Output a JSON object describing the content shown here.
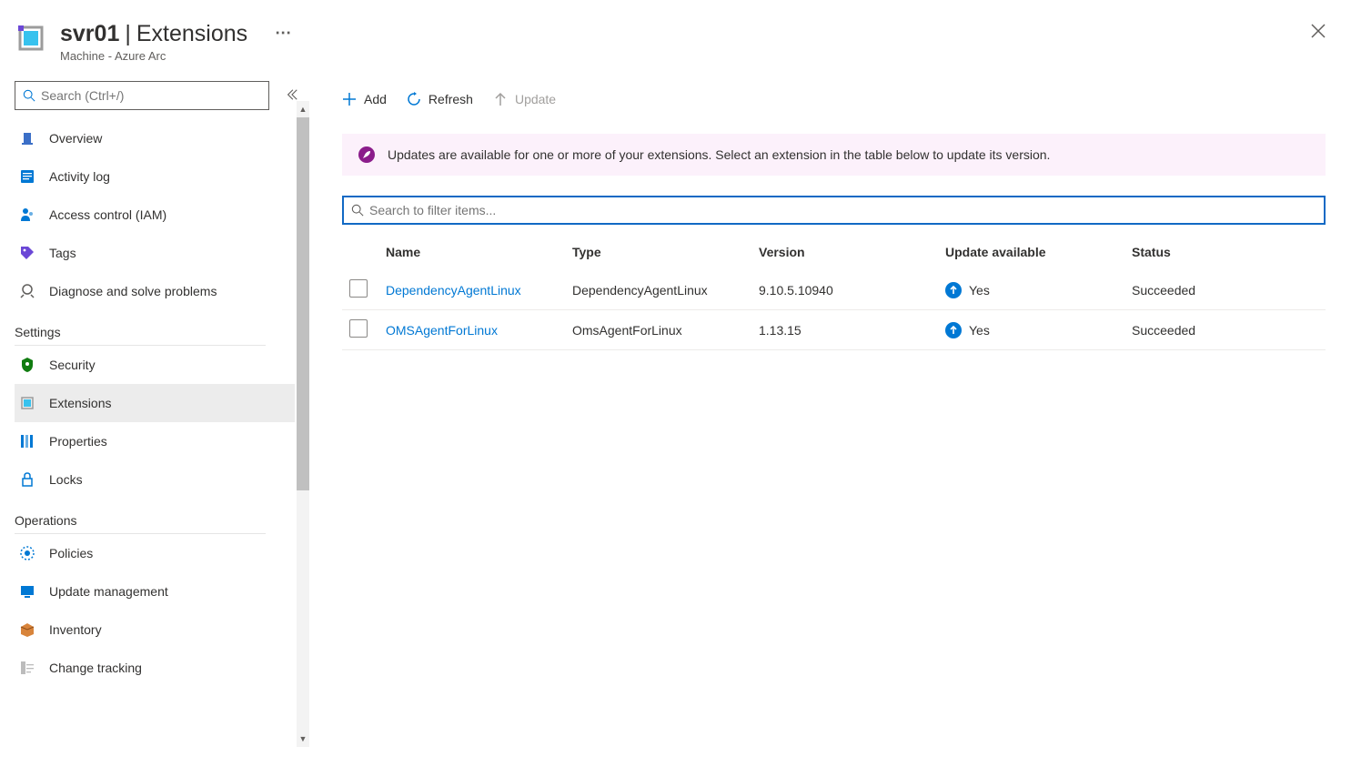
{
  "header": {
    "resource_name": "svr01",
    "section_title": "Extensions",
    "subtitle": "Machine - Azure Arc"
  },
  "sidebar": {
    "search_placeholder": "Search (Ctrl+/)",
    "items_top": [
      {
        "label": "Overview",
        "icon": "overview"
      },
      {
        "label": "Activity log",
        "icon": "activity"
      },
      {
        "label": "Access control (IAM)",
        "icon": "iam"
      },
      {
        "label": "Tags",
        "icon": "tags"
      },
      {
        "label": "Diagnose and solve problems",
        "icon": "diagnose"
      }
    ],
    "section_settings": "Settings",
    "items_settings": [
      {
        "label": "Security",
        "icon": "security"
      },
      {
        "label": "Extensions",
        "icon": "extensions",
        "selected": true
      },
      {
        "label": "Properties",
        "icon": "properties"
      },
      {
        "label": "Locks",
        "icon": "locks"
      }
    ],
    "section_operations": "Operations",
    "items_operations": [
      {
        "label": "Policies",
        "icon": "policies"
      },
      {
        "label": "Update management",
        "icon": "update"
      },
      {
        "label": "Inventory",
        "icon": "inventory"
      },
      {
        "label": "Change tracking",
        "icon": "change"
      }
    ]
  },
  "toolbar": {
    "add": "Add",
    "refresh": "Refresh",
    "update": "Update"
  },
  "banner": {
    "text": "Updates are available for one or more of your extensions. Select an extension in the table below to update its version."
  },
  "filter": {
    "placeholder": "Search to filter items..."
  },
  "table": {
    "headers": {
      "name": "Name",
      "type": "Type",
      "version": "Version",
      "update": "Update available",
      "status": "Status"
    },
    "rows": [
      {
        "name": "DependencyAgentLinux",
        "type": "DependencyAgentLinux",
        "version": "9.10.5.10940",
        "update": "Yes",
        "status": "Succeeded"
      },
      {
        "name": "OMSAgentForLinux",
        "type": "OmsAgentForLinux",
        "version": "1.13.15",
        "update": "Yes",
        "status": "Succeeded"
      }
    ]
  }
}
